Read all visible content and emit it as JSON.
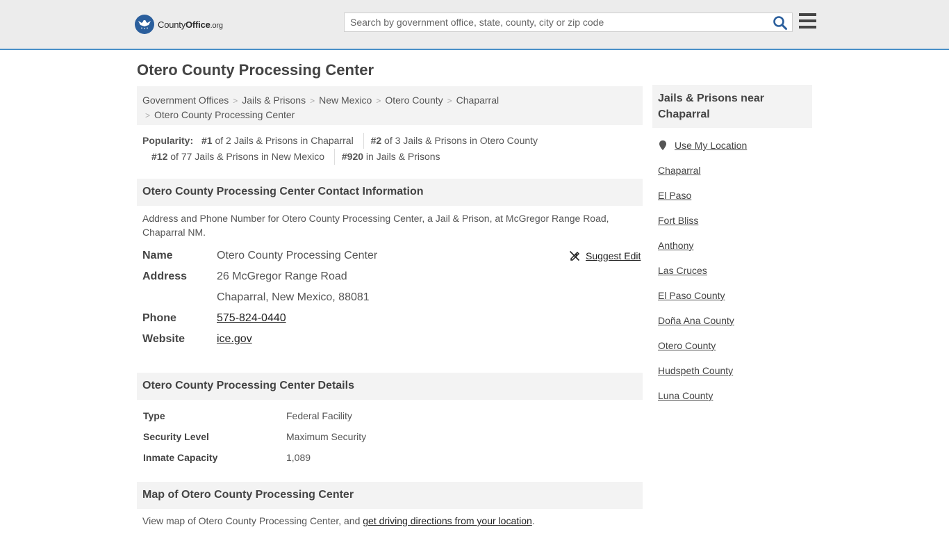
{
  "header": {
    "logo_county": "County",
    "logo_office": "Office",
    "logo_org": ".org",
    "search_placeholder": "Search by government office, state, county, city or zip code"
  },
  "page_title": "Otero County Processing Center",
  "breadcrumb": [
    "Government Offices",
    "Jails & Prisons",
    "New Mexico",
    "Otero County",
    "Chaparral",
    "Otero County Processing Center"
  ],
  "popularity": {
    "label": "Popularity:",
    "items": [
      {
        "rank": "#1",
        "text": " of 2 Jails & Prisons in Chaparral"
      },
      {
        "rank": "#2",
        "text": " of 3 Jails & Prisons in Otero County"
      },
      {
        "rank": "#12",
        "text": " of 77 Jails & Prisons in New Mexico"
      },
      {
        "rank": "#920",
        "text": " in Jails & Prisons"
      }
    ]
  },
  "contact": {
    "heading": "Otero County Processing Center Contact Information",
    "description": "Address and Phone Number for Otero County Processing Center, a Jail & Prison, at McGregor Range Road, Chaparral NM.",
    "suggest_edit": "Suggest Edit",
    "name_label": "Name",
    "name_value": "Otero County Processing Center",
    "address_label": "Address",
    "address_line1": "26 McGregor Range Road",
    "address_line2": "Chaparral, New Mexico, 88081",
    "phone_label": "Phone",
    "phone_value": "575-824-0440",
    "website_label": "Website",
    "website_value": "ice.gov"
  },
  "details": {
    "heading": "Otero County Processing Center Details",
    "rows": [
      {
        "label": "Type",
        "value": "Federal Facility"
      },
      {
        "label": "Security Level",
        "value": "Maximum Security"
      },
      {
        "label": "Inmate Capacity",
        "value": "1,089"
      }
    ]
  },
  "map": {
    "heading": "Map of Otero County Processing Center",
    "text_before": "View map of Otero County Processing Center, and ",
    "link": "get driving directions from your location",
    "text_after": "."
  },
  "sidebar": {
    "heading": "Jails & Prisons near Chaparral",
    "use_location": "Use My Location",
    "links": [
      "Chaparral",
      "El Paso",
      "Fort Bliss",
      "Anthony",
      "Las Cruces",
      "El Paso County",
      "Doña Ana County",
      "Otero County",
      "Hudspeth County",
      "Luna County"
    ]
  },
  "colors": {
    "header_bg": "#ececec",
    "header_border": "#4a90c8",
    "logo_blue": "#2a5e9c",
    "search_icon": "#2a5e9c"
  }
}
